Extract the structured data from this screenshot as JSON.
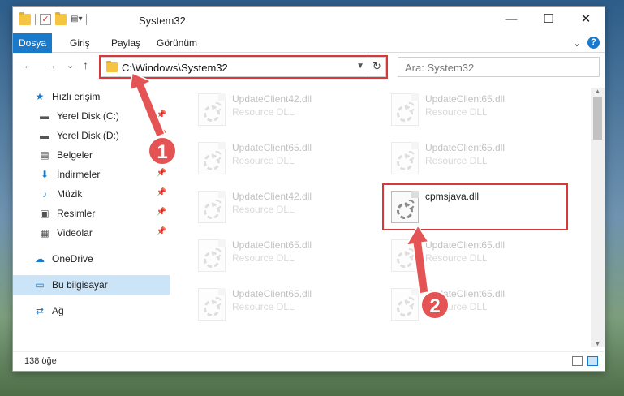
{
  "titlebar": {
    "title": "System32",
    "minimize": "—",
    "maximize": "☐",
    "close": "✕"
  },
  "ribbon": {
    "tabs": [
      "Dosya",
      "Giriş",
      "Paylaş",
      "Görünüm"
    ],
    "expand": "⌄",
    "help": "?"
  },
  "navigation": {
    "back": "←",
    "forward": "→",
    "recent": "⌄",
    "up": "↑",
    "address": "C:\\Windows\\System32",
    "refresh": "↻",
    "search_placeholder": "Ara: System32"
  },
  "sidebar": {
    "items": [
      {
        "label": "Hızlı erişim",
        "icon": "star-icon",
        "pinned": false
      },
      {
        "label": "Yerel Disk (C:)",
        "icon": "drive-icon",
        "pinned": true
      },
      {
        "label": "Yerel Disk (D:)",
        "icon": "drive-icon",
        "pinned": true
      },
      {
        "label": "Belgeler",
        "icon": "documents-icon",
        "pinned": true
      },
      {
        "label": "İndirmeler",
        "icon": "download-icon",
        "pinned": true
      },
      {
        "label": "Müzik",
        "icon": "music-icon",
        "pinned": true
      },
      {
        "label": "Resimler",
        "icon": "pictures-icon",
        "pinned": true
      },
      {
        "label": "Videolar",
        "icon": "videos-icon",
        "pinned": true
      },
      {
        "label": "OneDrive",
        "icon": "cloud-icon",
        "pinned": false
      },
      {
        "label": "Bu bilgisayar",
        "icon": "computer-icon",
        "pinned": false,
        "selected": true
      },
      {
        "label": "Ağ",
        "icon": "network-icon",
        "pinned": false
      }
    ]
  },
  "files": {
    "left_column": [
      {
        "name": "UpdateClient42.dll",
        "type": "Resource DLL"
      },
      {
        "name": "UpdateClient65.dll",
        "type": "Resource DLL"
      },
      {
        "name": "UpdateClient42.dll",
        "type": "Resource DLL"
      },
      {
        "name": "UpdateClient65.dll",
        "type": "Resource DLL"
      },
      {
        "name": "UpdateClient65.dll",
        "type": "Resource DLL"
      }
    ],
    "right_column": [
      {
        "name": "UpdateClient65.dll",
        "type": "Resource DLL"
      },
      {
        "name": "UpdateClient65.dll",
        "type": "Resource DLL"
      },
      {
        "name": "cpmsjava.dll",
        "type": "",
        "highlighted": true
      },
      {
        "name": "UpdateClient65.dll",
        "type": "Resource DLL"
      },
      {
        "name": "UpdateClient65.dll",
        "type": "Resource DLL"
      }
    ]
  },
  "status": {
    "item_count": "138 öğe"
  },
  "annotations": {
    "callout_1": "1",
    "callout_2": "2",
    "highlight_color": "#d9383a"
  }
}
